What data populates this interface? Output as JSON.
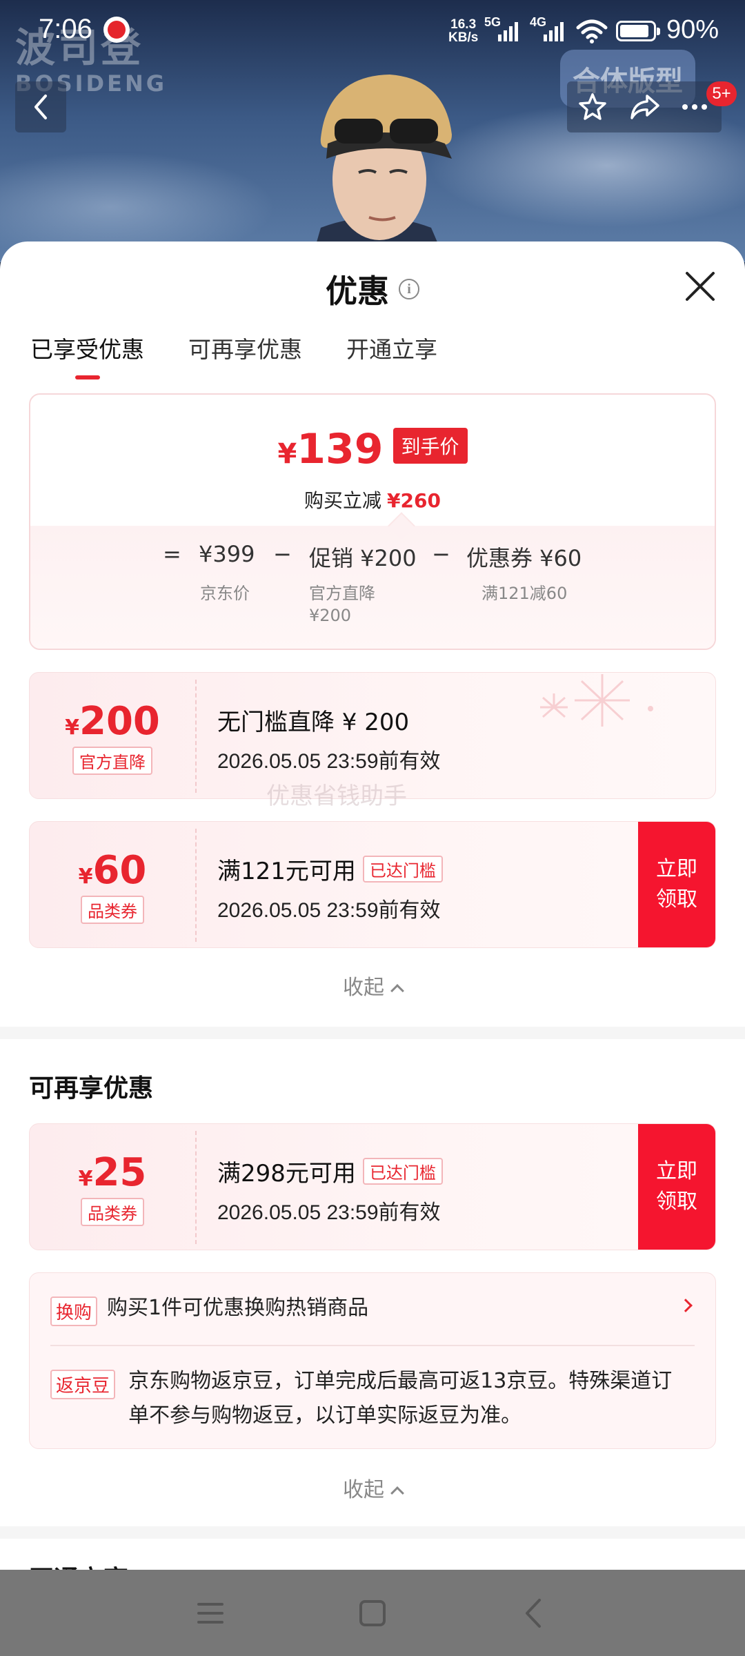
{
  "status_bar": {
    "time": "7:06",
    "net_speed": "16.3",
    "net_unit": "KB/s",
    "sig1": "5G",
    "sig2": "4G",
    "battery_pct": "90%",
    "battery_level": 0.9
  },
  "hero": {
    "brand_cn": "波司登",
    "brand_en": "BOSIDENG",
    "style_badge": "合体版型",
    "notify_badge": "5+"
  },
  "sheet": {
    "title": "优惠",
    "tabs": [
      "已享受优惠",
      "可再享优惠",
      "开通立享"
    ],
    "summary": {
      "yen": "¥",
      "price": "139",
      "price_tag": "到手价",
      "save_label": "购买立减",
      "save_amount": "¥260",
      "eq": "=",
      "minus1": "−",
      "minus2": "−",
      "item1": "¥399",
      "item1_sub": "京东价",
      "item2": "促销 ¥200",
      "item2_sub1": "官方直降",
      "item2_sub2": "¥200",
      "item3": "优惠券 ¥60",
      "item3_sub": "满121减60"
    },
    "coupons_enjoyed": [
      {
        "yen": "¥",
        "amount": "200",
        "tag": "官方直降",
        "line1": "无门槛直降 ¥ 200",
        "line2": "2026.05.05 23:59前有效"
      },
      {
        "yen": "¥",
        "amount": "60",
        "tag": "品类券",
        "line1": "满121元可用",
        "cond": "已达门槛",
        "line2": "2026.05.05 23:59前有效",
        "claim1": "立即",
        "claim2": "领取"
      }
    ],
    "watermark": "优惠省钱助手",
    "collapse_label": "收起",
    "section2_title": "可再享优惠",
    "coupons_more": [
      {
        "yen": "¥",
        "amount": "25",
        "tag": "品类券",
        "line1": "满298元可用",
        "cond": "已达门槛",
        "line2": "2026.05.05 23:59前有效",
        "claim1": "立即",
        "claim2": "领取"
      }
    ],
    "extras": {
      "swap_tag": "换购",
      "swap_text": "购买1件可优惠换购热销商品",
      "bean_tag": "返京豆",
      "bean_text1": "京东购物返京豆，订单完成后最高可返13京豆。特殊渠道订",
      "bean_text2": "单不参与购物返豆，以订单实际返豆为准。"
    },
    "collapse_label2": "收起",
    "section3_title": "开通立享"
  },
  "icons": [
    "back-icon",
    "star-icon",
    "share-icon",
    "more-icon",
    "info-icon",
    "close-icon",
    "chevron-up-icon",
    "chevron-right-icon",
    "menu-icon",
    "home-icon",
    "nav-back-icon"
  ],
  "colors": {
    "accent": "#e8252f",
    "claim": "#f5152f"
  }
}
